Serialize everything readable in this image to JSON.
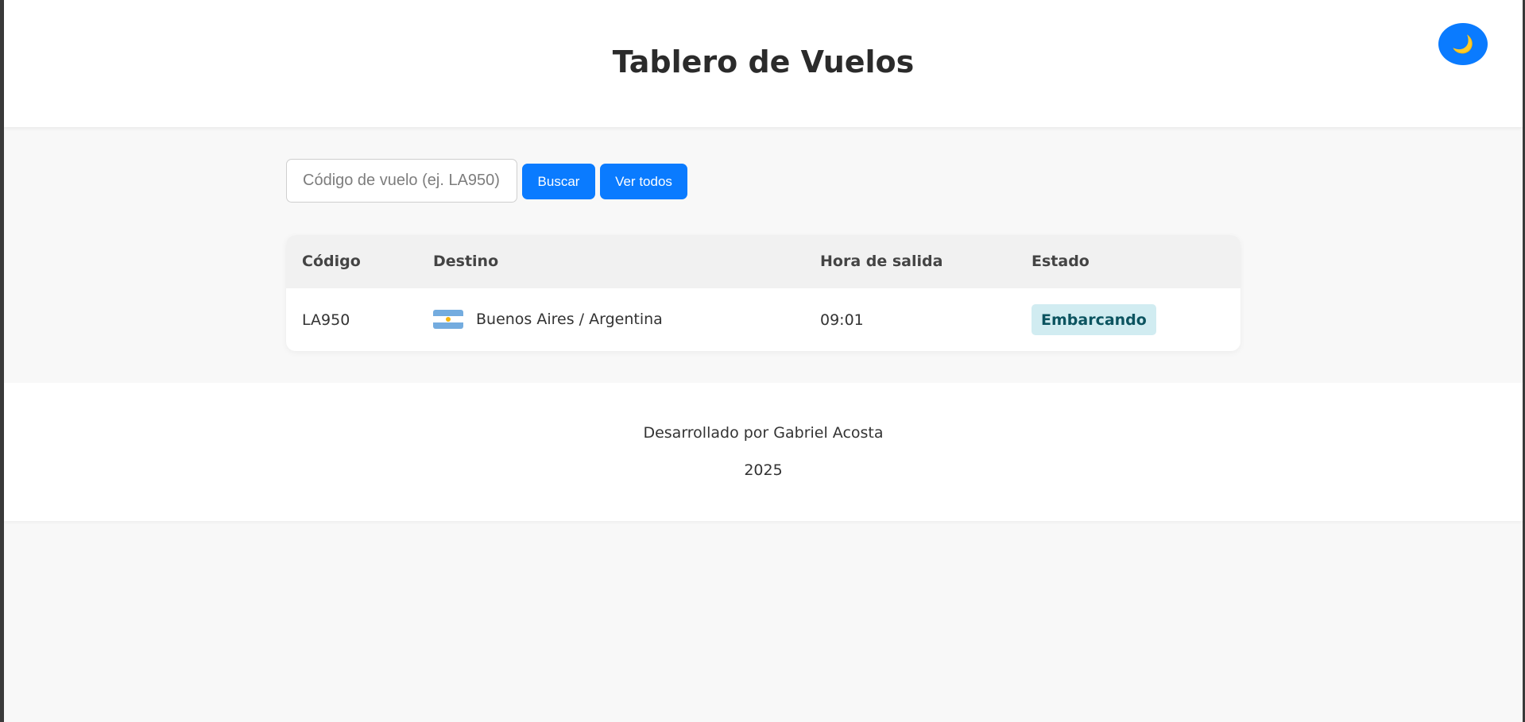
{
  "header": {
    "title": "Tablero de Vuelos",
    "theme_toggle": {
      "icon": "moon-icon",
      "glyph": "🌙",
      "color": "#0a7bff"
    }
  },
  "search": {
    "placeholder": "Código de vuelo (ej. LA950)",
    "value": "",
    "search_label": "Buscar",
    "view_all_label": "Ver todos",
    "button_color": "#0a7bff"
  },
  "table": {
    "columns": [
      "Código",
      "Destino",
      "Hora de salida",
      "Estado"
    ],
    "rows": [
      {
        "code": "LA950",
        "flag_icon": "argentina-flag-icon",
        "flag_colors": [
          "#74acdf",
          "#ffffff",
          "#74acdf"
        ],
        "flag_sun_color": "#f6b40e",
        "destination": "Buenos Aires / Argentina",
        "departure": "09:01",
        "status": "Embarcando",
        "status_bg": "#d1ecf1",
        "status_fg": "#0c5460"
      }
    ]
  },
  "footer": {
    "credit": "Desarrollado por Gabriel Acosta",
    "year": "2025"
  }
}
